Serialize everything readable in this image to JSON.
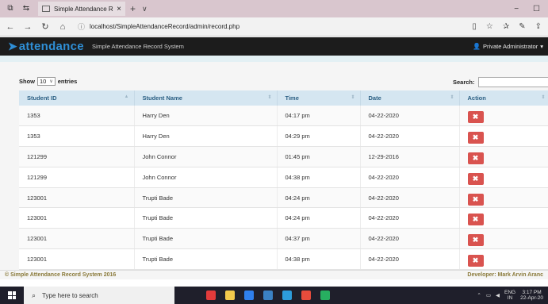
{
  "browser": {
    "tab_title": "Simple Attendance Reco",
    "new_tab": "+",
    "tab_menu": "∨",
    "url": "localhost/SimpleAttendanceRecord/admin/record.php",
    "window_controls": [
      "−",
      "☐"
    ]
  },
  "navbar": {
    "brand": "attendance",
    "subtitle": "Simple Attendance Record System",
    "user": "Private Administrator"
  },
  "controls": {
    "show_label": "Show",
    "length_value": "10",
    "entries_label": "entries",
    "search_label": "Search:",
    "search_value": ""
  },
  "table": {
    "columns": [
      "Student ID",
      "Student Name",
      "Time",
      "Date",
      "Action"
    ],
    "rows": [
      {
        "id": "1353",
        "name": "Harry Den",
        "time": "04:17 pm",
        "date": "04-22-2020"
      },
      {
        "id": "1353",
        "name": "Harry Den",
        "time": "04:29 pm",
        "date": "04-22-2020"
      },
      {
        "id": "121299",
        "name": "John Connor",
        "time": "01:45 pm",
        "date": "12-29-2016"
      },
      {
        "id": "121299",
        "name": "John Connor",
        "time": "04:38 pm",
        "date": "04-22-2020"
      },
      {
        "id": "123001",
        "name": "Trupti Bade",
        "time": "04:24 pm",
        "date": "04-22-2020"
      },
      {
        "id": "123001",
        "name": "Trupti Bade",
        "time": "04:24 pm",
        "date": "04-22-2020"
      },
      {
        "id": "123001",
        "name": "Trupti Bade",
        "time": "04:37 pm",
        "date": "04-22-2020"
      },
      {
        "id": "123001",
        "name": "Trupti Bade",
        "time": "04:38 pm",
        "date": "04-22-2020"
      }
    ],
    "delete_glyph": "✖"
  },
  "footer": {
    "left": "© Simple Attendance Record System 2016",
    "right": "Developer: Mark Arvin Aranc"
  },
  "taskbar": {
    "search_placeholder": "Type here to search",
    "lang_top": "ENG",
    "lang_bottom": "IN",
    "time": "3:17 PM",
    "date": "22-Apr-20",
    "app_colors": [
      "#e23b3b",
      "#f2c94c",
      "#2f80ed",
      "#3b82c4",
      "#2d9cdb",
      "#e74c3c",
      "#27ae60"
    ]
  },
  "colors": {
    "navbar_bg": "#1c1c1c",
    "brand": "#2f8fd6",
    "header_bg": "#d5e6f1",
    "delete_btn": "#d9534f",
    "footer_text": "#8a7a3a"
  }
}
